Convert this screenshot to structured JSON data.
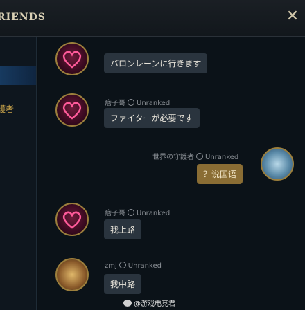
{
  "header": {
    "title": "RIENDS",
    "close_symbol": "✕"
  },
  "sidebar": {
    "label": "護者"
  },
  "messages": [
    {
      "sender": "",
      "status": "",
      "text": "バロンレーンに行きます",
      "avatar": "heart-avatar"
    },
    {
      "sender": "痞子哥",
      "status": "Unranked",
      "text": "ファイターが必要です",
      "avatar": "heart-avatar"
    },
    {
      "sender": "世界の守護者",
      "status": "Unranked",
      "text": "？说国语",
      "avatar": "poro-avatar"
    },
    {
      "sender": "痞子哥",
      "status": "Unranked",
      "text": "我上路",
      "avatar": "heart-avatar"
    },
    {
      "sender": "zmj",
      "status": "Unranked",
      "text": "我中路",
      "avatar": "cake-avatar"
    }
  ],
  "watermark": {
    "text": "@游戏电竞君"
  },
  "colors": {
    "accent_gold": "#9c7f3c",
    "self_bubble": "#8a6d34",
    "bubble": "#2a343e"
  }
}
